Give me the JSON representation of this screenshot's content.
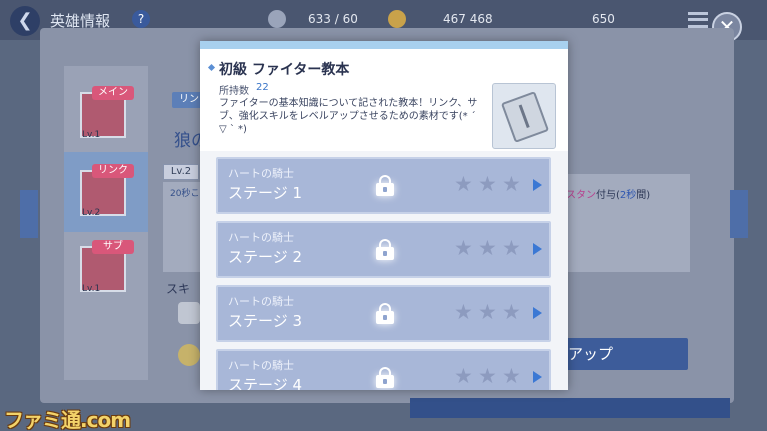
{
  "background": {
    "screen_title": "英雄情報",
    "resources": [
      "633 / 60",
      "467 468",
      "650"
    ],
    "slots": [
      {
        "tag": "メイン",
        "level": "Lv.1",
        "tag_color": "#d9577a"
      },
      {
        "tag": "リンク",
        "level": "Lv.2",
        "tag_color": "#d9577a"
      },
      {
        "tag": "サブ",
        "level": "Lv.1",
        "tag_color": "#d9577a"
      }
    ],
    "link_tag": "リン",
    "hero_name_partial": "狼の",
    "skill_level": "Lv.2",
    "skill_desc_partial": "20秒こ",
    "right_text": {
      "part1": "スタン",
      "part2": "付与(",
      "part3": "2秒",
      "part4": "間)"
    },
    "skill_label_partial": "スキ",
    "upgrade_button": "アップ"
  },
  "popup": {
    "title": "初級 ファイター教本",
    "quantity_label": "所持数",
    "quantity_value": "22",
    "description": "ファイターの基本知識について記された教本！リンク、サブ、強化スキルをレベルアップさせるための素材です(* ´ ▽ ` *)",
    "item_icon": "book-icon",
    "stages": [
      {
        "boss": "ハートの騎士",
        "stage": "ステージ 1",
        "stars": 3,
        "locked": true
      },
      {
        "boss": "ハートの騎士",
        "stage": "ステージ 2",
        "stars": 3,
        "locked": true
      },
      {
        "boss": "ハートの騎士",
        "stage": "ステージ 3",
        "stars": 3,
        "locked": true
      },
      {
        "boss": "ハートの騎士",
        "stage": "ステージ 4",
        "stars": 3,
        "locked": true
      }
    ]
  },
  "watermark": "ファミ通.com",
  "colors": {
    "accent_blue": "#3b76c8",
    "stage_row": "#a8b7d8",
    "star": "#8d9bbf"
  }
}
